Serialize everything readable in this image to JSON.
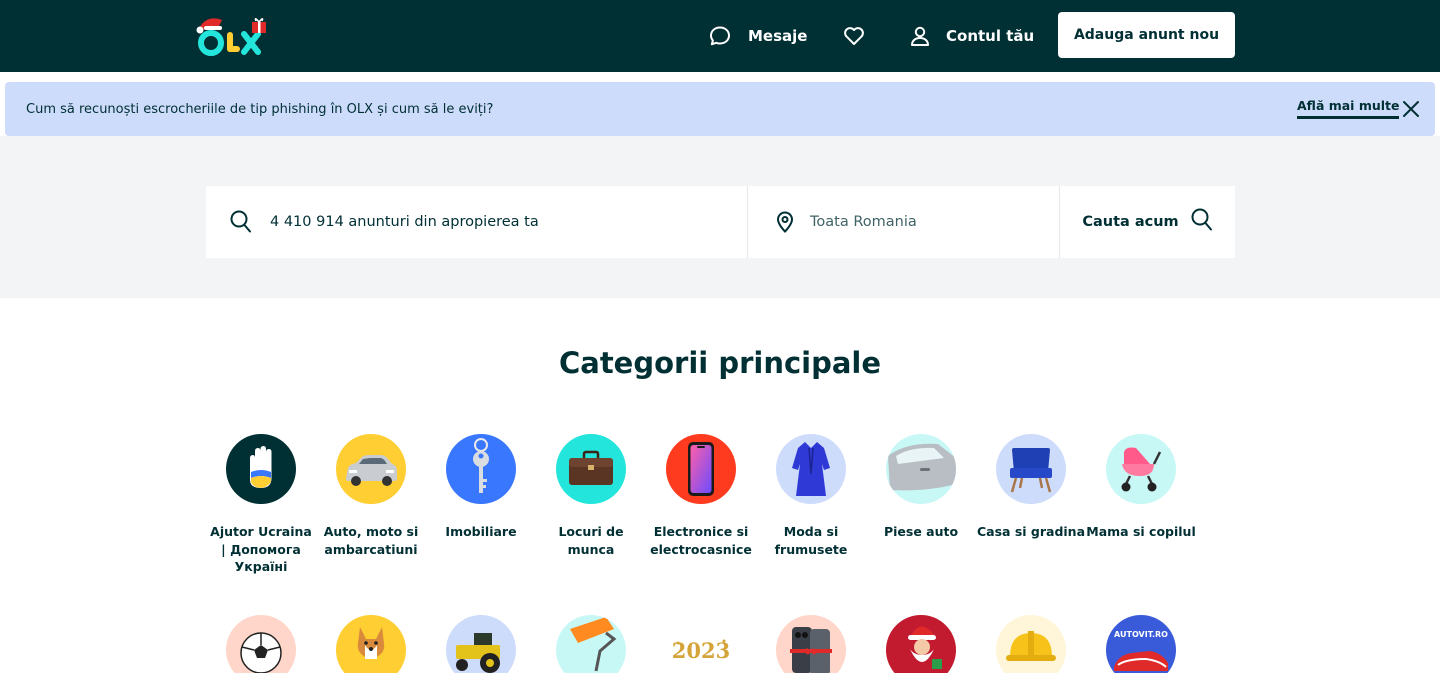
{
  "header": {
    "logo_text": "OLX",
    "messages_label": "Mesaje",
    "favorites_icon": "heart-icon",
    "account_label": "Contul tău",
    "post_ad_label": "Adauga anunt nou"
  },
  "banner": {
    "text": "Cum să recunoști escrocheriile de tip phishing în OLX și cum să le eviți?",
    "link_label": "Află mai multe",
    "close_icon": "close-icon"
  },
  "search": {
    "query_placeholder": "4 410 914 anunturi din apropierea ta",
    "location_placeholder": "Toata Romania",
    "button_label": "Cauta acum"
  },
  "categories": {
    "title": "Categorii principale",
    "row1": [
      {
        "label": "Ajutor Ucraina | Допомога Україні",
        "color": "#002f34"
      },
      {
        "label": "Auto, moto si ambarcatiuni",
        "color": "#ffce32"
      },
      {
        "label": "Imobiliare",
        "color": "#3a77ff"
      },
      {
        "label": "Locuri de munca",
        "color": "#23e5db"
      },
      {
        "label": "Electronice si electrocasnice",
        "color": "#ff5636"
      },
      {
        "label": "Moda si frumusete",
        "color": "#cedcfb"
      },
      {
        "label": "Piese auto",
        "color": "#c8f8f6"
      },
      {
        "label": "Casa si gradina",
        "color": "#cedcfb"
      },
      {
        "label": "Mama si copilul",
        "color": "#c8f8f6"
      }
    ],
    "row2": [
      {
        "color": "#ffd6c9"
      },
      {
        "color": "#ffce32"
      },
      {
        "color": "#cedcfb"
      },
      {
        "color": "#c8f8f6"
      },
      {
        "color": "#ffffff",
        "text": "2023"
      },
      {
        "color": "#ffd6c9"
      },
      {
        "color": "#c21a2f"
      },
      {
        "color": "#fff6d9"
      },
      {
        "color": "#3a5bd9",
        "text": "AUTOVIT.RO"
      }
    ]
  }
}
